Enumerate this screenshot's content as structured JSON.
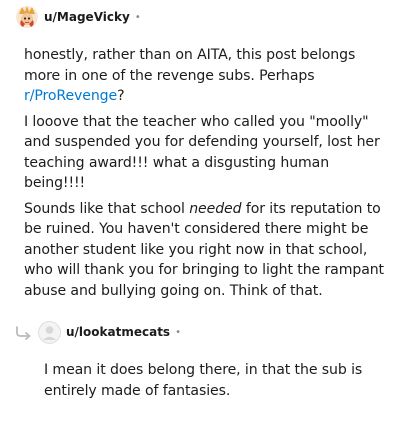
{
  "comments": [
    {
      "username": "u/MageVicky",
      "separator": "•",
      "avatar": "mage-avatar-icon",
      "paragraphs": {
        "p1_before": "honestly, rather than on AITA, this post belongs more in one of the revenge subs. Perhaps ",
        "p1_link": "r/ProRevenge",
        "p1_after": "?",
        "p2": "I looove that the teacher who called you \"moolly\" and suspended you for defending yourself, lost her teaching award!!! what a disgusting human being!!!!",
        "p3_before": "Sounds like that school ",
        "p3_emph": "needed",
        "p3_after": " for its reputation to be ruined. You haven't considered there might be another student like you right now in that school, who will thank you for bringing to light the rampant abuse and bullying going on. Think of that."
      }
    },
    {
      "username": "u/lookatmecats",
      "separator": "•",
      "avatar": "default-avatar-icon",
      "reply_icon": "reply-arrow-icon",
      "paragraphs": {
        "p1": "I mean it does belong there, in that the sub is entirely made of fantasies."
      }
    }
  ],
  "colors": {
    "link": "#0079d3",
    "text": "#1c1c1c",
    "muted": "#878a8c"
  }
}
